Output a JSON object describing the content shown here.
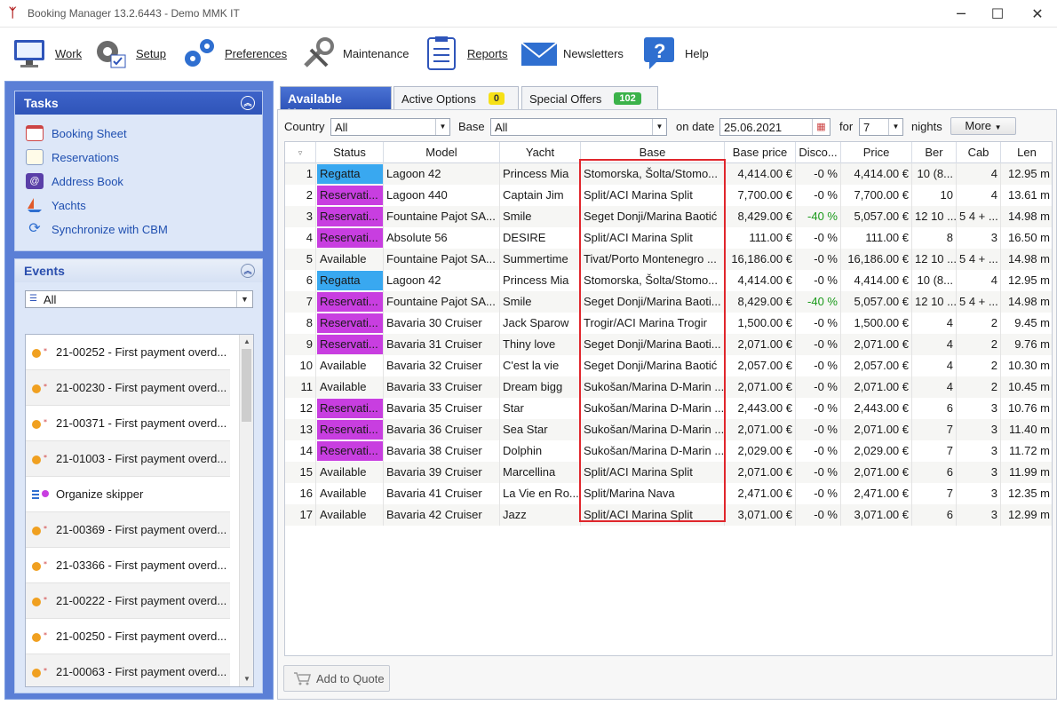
{
  "window": {
    "title": "Booking Manager 13.2.6443 - Demo MMK IT"
  },
  "toolbar": {
    "items": [
      {
        "label": "Work",
        "icon": "monitor-icon"
      },
      {
        "label": "Setup",
        "icon": "gears-icon"
      },
      {
        "label": "Preferences",
        "icon": "blue-gears-icon"
      },
      {
        "label": "Maintenance",
        "icon": "wrench-icon"
      },
      {
        "label": "Reports",
        "icon": "clipboard-icon"
      },
      {
        "label": "Newsletters",
        "icon": "envelope-icon"
      },
      {
        "label": "Help",
        "icon": "help-bubble-icon"
      }
    ]
  },
  "tasks": {
    "title": "Tasks",
    "items": [
      {
        "label": "Booking Sheet",
        "icon": "calendar-icon"
      },
      {
        "label": "Reservations",
        "icon": "notepad-icon"
      },
      {
        "label": "Address Book",
        "icon": "at-book-icon"
      },
      {
        "label": "Yachts",
        "icon": "sailboat-icon"
      },
      {
        "label": "Synchronize with CBM",
        "icon": "sync-icon"
      }
    ]
  },
  "events": {
    "title": "Events",
    "filter": "All",
    "items": [
      "21-00252 - First payment overd...",
      "21-00230 - First payment overd...",
      "21-00371 - First payment overd...",
      "21-01003 - First payment overd...",
      "Organize skipper",
      "21-00369 - First payment overd...",
      "21-03366 - First payment overd...",
      "21-00222 - First payment overd...",
      "21-00250 - First payment overd...",
      "21-00063 - First payment overd..."
    ]
  },
  "tabs": [
    {
      "label": "Available Yachts",
      "badge": ""
    },
    {
      "label": "Active Options",
      "badge": "0"
    },
    {
      "label": "Special Offers",
      "badge": "102"
    }
  ],
  "filters": {
    "country_label": "Country",
    "country_value": "All",
    "base_label": "Base",
    "base_value": "All",
    "date_label": "on date",
    "date_value": "25.06.2021",
    "for_label": "for",
    "nights_value": "7",
    "nights_label": "nights",
    "more_label": "More"
  },
  "grid": {
    "columns": [
      "Status",
      "Model",
      "Yacht",
      "Base",
      "Base price",
      "Disco...",
      "Price",
      "Ber",
      "Cab",
      "Len"
    ],
    "rows": [
      {
        "n": "1",
        "status": "Regatta",
        "model": "Lagoon 42",
        "yacht": "Princess Mia",
        "base": "Stomorska, Šolta/Stomo...",
        "base_price": "4,414.00 €",
        "disc": "-0 %",
        "price": "4,414.00 €",
        "ber": "10 (8...",
        "cab": "4",
        "len": "12.95 m"
      },
      {
        "n": "2",
        "status": "Reservati...",
        "model": "Lagoon 440",
        "yacht": "Captain Jim",
        "base": "Split/ACI Marina Split",
        "base_price": "7,700.00 €",
        "disc": "-0 %",
        "price": "7,700.00 €",
        "ber": "10",
        "cab": "4",
        "len": "13.61 m"
      },
      {
        "n": "3",
        "status": "Reservati...",
        "model": "Fountaine Pajot SA...",
        "yacht": "Smile",
        "base": "Seget Donji/Marina Baotić",
        "base_price": "8,429.00 €",
        "disc": "-40 %",
        "price": "5,057.00 €",
        "ber": "12 10 ...",
        "cab": "5 4 + ...",
        "len": "14.98 m"
      },
      {
        "n": "4",
        "status": "Reservati...",
        "model": "Absolute 56",
        "yacht": "DESIRE",
        "base": "Split/ACI Marina Split",
        "base_price": "111.00 €",
        "disc": "-0 %",
        "price": "111.00 €",
        "ber": "8",
        "cab": "3",
        "len": "16.50 m"
      },
      {
        "n": "5",
        "status": "Available",
        "model": "Fountaine Pajot SA...",
        "yacht": "Summertime",
        "base": "Tivat/Porto Montenegro ...",
        "base_price": "16,186.00 €",
        "disc": "-0 %",
        "price": "16,186.00 €",
        "ber": "12 10 ...",
        "cab": "5 4 + ...",
        "len": "14.98 m"
      },
      {
        "n": "6",
        "status": "Regatta",
        "model": "Lagoon 42",
        "yacht": "Princess Mia",
        "base": "Stomorska, Šolta/Stomo...",
        "base_price": "4,414.00 €",
        "disc": "-0 %",
        "price": "4,414.00 €",
        "ber": "10 (8...",
        "cab": "4",
        "len": "12.95 m"
      },
      {
        "n": "7",
        "status": "Reservati...",
        "model": "Fountaine Pajot SA...",
        "yacht": "Smile",
        "base": "Seget Donji/Marina Baoti...",
        "base_price": "8,429.00 €",
        "disc": "-40 %",
        "price": "5,057.00 €",
        "ber": "12 10 ...",
        "cab": "5 4 + ...",
        "len": "14.98 m"
      },
      {
        "n": "8",
        "status": "Reservati...",
        "model": "Bavaria 30 Cruiser",
        "yacht": "Jack Sparow",
        "base": "Trogir/ACI Marina Trogir",
        "base_price": "1,500.00 €",
        "disc": "-0 %",
        "price": "1,500.00 €",
        "ber": "4",
        "cab": "2",
        "len": "9.45 m"
      },
      {
        "n": "9",
        "status": "Reservati...",
        "model": "Bavaria 31 Cruiser",
        "yacht": "Thiny love",
        "base": "Seget Donji/Marina Baoti...",
        "base_price": "2,071.00 €",
        "disc": "-0 %",
        "price": "2,071.00 €",
        "ber": "4",
        "cab": "2",
        "len": "9.76 m"
      },
      {
        "n": "10",
        "status": "Available",
        "model": "Bavaria 32 Cruiser",
        "yacht": "C'est la vie",
        "base": "Seget Donji/Marina Baotić",
        "base_price": "2,057.00 €",
        "disc": "-0 %",
        "price": "2,057.00 €",
        "ber": "4",
        "cab": "2",
        "len": "10.30 m"
      },
      {
        "n": "11",
        "status": "Available",
        "model": "Bavaria 33 Cruiser",
        "yacht": "Dream bigg",
        "base": "Sukošan/Marina D-Marin ...",
        "base_price": "2,071.00 €",
        "disc": "-0 %",
        "price": "2,071.00 €",
        "ber": "4",
        "cab": "2",
        "len": "10.45 m"
      },
      {
        "n": "12",
        "status": "Reservati...",
        "model": "Bavaria 35 Cruiser",
        "yacht": "Star",
        "base": "Sukošan/Marina D-Marin ...",
        "base_price": "2,443.00 €",
        "disc": "-0 %",
        "price": "2,443.00 €",
        "ber": "6",
        "cab": "3",
        "len": "10.76 m"
      },
      {
        "n": "13",
        "status": "Reservati...",
        "model": "Bavaria 36 Cruiser",
        "yacht": "Sea Star",
        "base": "Sukošan/Marina D-Marin ...",
        "base_price": "2,071.00 €",
        "disc": "-0 %",
        "price": "2,071.00 €",
        "ber": "7",
        "cab": "3",
        "len": "11.40 m"
      },
      {
        "n": "14",
        "status": "Reservati...",
        "model": "Bavaria 38 Cruiser",
        "yacht": "Dolphin",
        "base": "Sukošan/Marina D-Marin ...",
        "base_price": "2,029.00 €",
        "disc": "-0 %",
        "price": "2,029.00 €",
        "ber": "7",
        "cab": "3",
        "len": "11.72 m"
      },
      {
        "n": "15",
        "status": "Available",
        "model": "Bavaria 39 Cruiser",
        "yacht": "Marcellina",
        "base": "Split/ACI Marina Split",
        "base_price": "2,071.00 €",
        "disc": "-0 %",
        "price": "2,071.00 €",
        "ber": "6",
        "cab": "3",
        "len": "11.99 m"
      },
      {
        "n": "16",
        "status": "Available",
        "model": "Bavaria 41 Cruiser",
        "yacht": "La Vie en Ro...",
        "base": "Split/Marina Nava",
        "base_price": "2,471.00 €",
        "disc": "-0 %",
        "price": "2,471.00 €",
        "ber": "7",
        "cab": "3",
        "len": "12.35 m"
      },
      {
        "n": "17",
        "status": "Available",
        "model": "Bavaria 42 Cruiser",
        "yacht": "Jazz",
        "base": "Split/ACI Marina Split",
        "base_price": "3,071.00 €",
        "disc": "-0 %",
        "price": "3,071.00 €",
        "ber": "6",
        "cab": "3",
        "len": "12.99 m"
      }
    ]
  },
  "footer": {
    "add_to_quote": "Add to Quote"
  },
  "colors": {
    "regatta": "#39a8f0",
    "reservation": "#c83ee0",
    "discount": "#1a9a1a",
    "highlight": "#e0262c",
    "accent": "#3d63c9"
  }
}
